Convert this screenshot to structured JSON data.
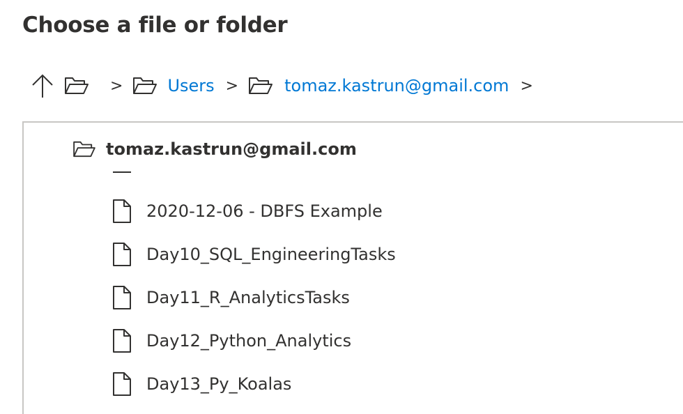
{
  "dialog": {
    "title": "Choose a file or folder"
  },
  "breadcrumb": {
    "separator": ">",
    "items": [
      {
        "label": "Users"
      },
      {
        "label": "tomaz.kastrun@gmail.com"
      }
    ]
  },
  "tree": {
    "root_label": "tomaz.kastrun@gmail.com",
    "files": [
      {
        "label": "2020-12-06 - DBFS Example"
      },
      {
        "label": "Day10_SQL_EngineeringTasks"
      },
      {
        "label": "Day11_R_AnalyticsTasks"
      },
      {
        "label": "Day12_Python_Analytics"
      },
      {
        "label": "Day13_Py_Koalas"
      }
    ]
  },
  "colors": {
    "link": "#0078d4",
    "text": "#323130",
    "border": "#c8c6c4"
  }
}
